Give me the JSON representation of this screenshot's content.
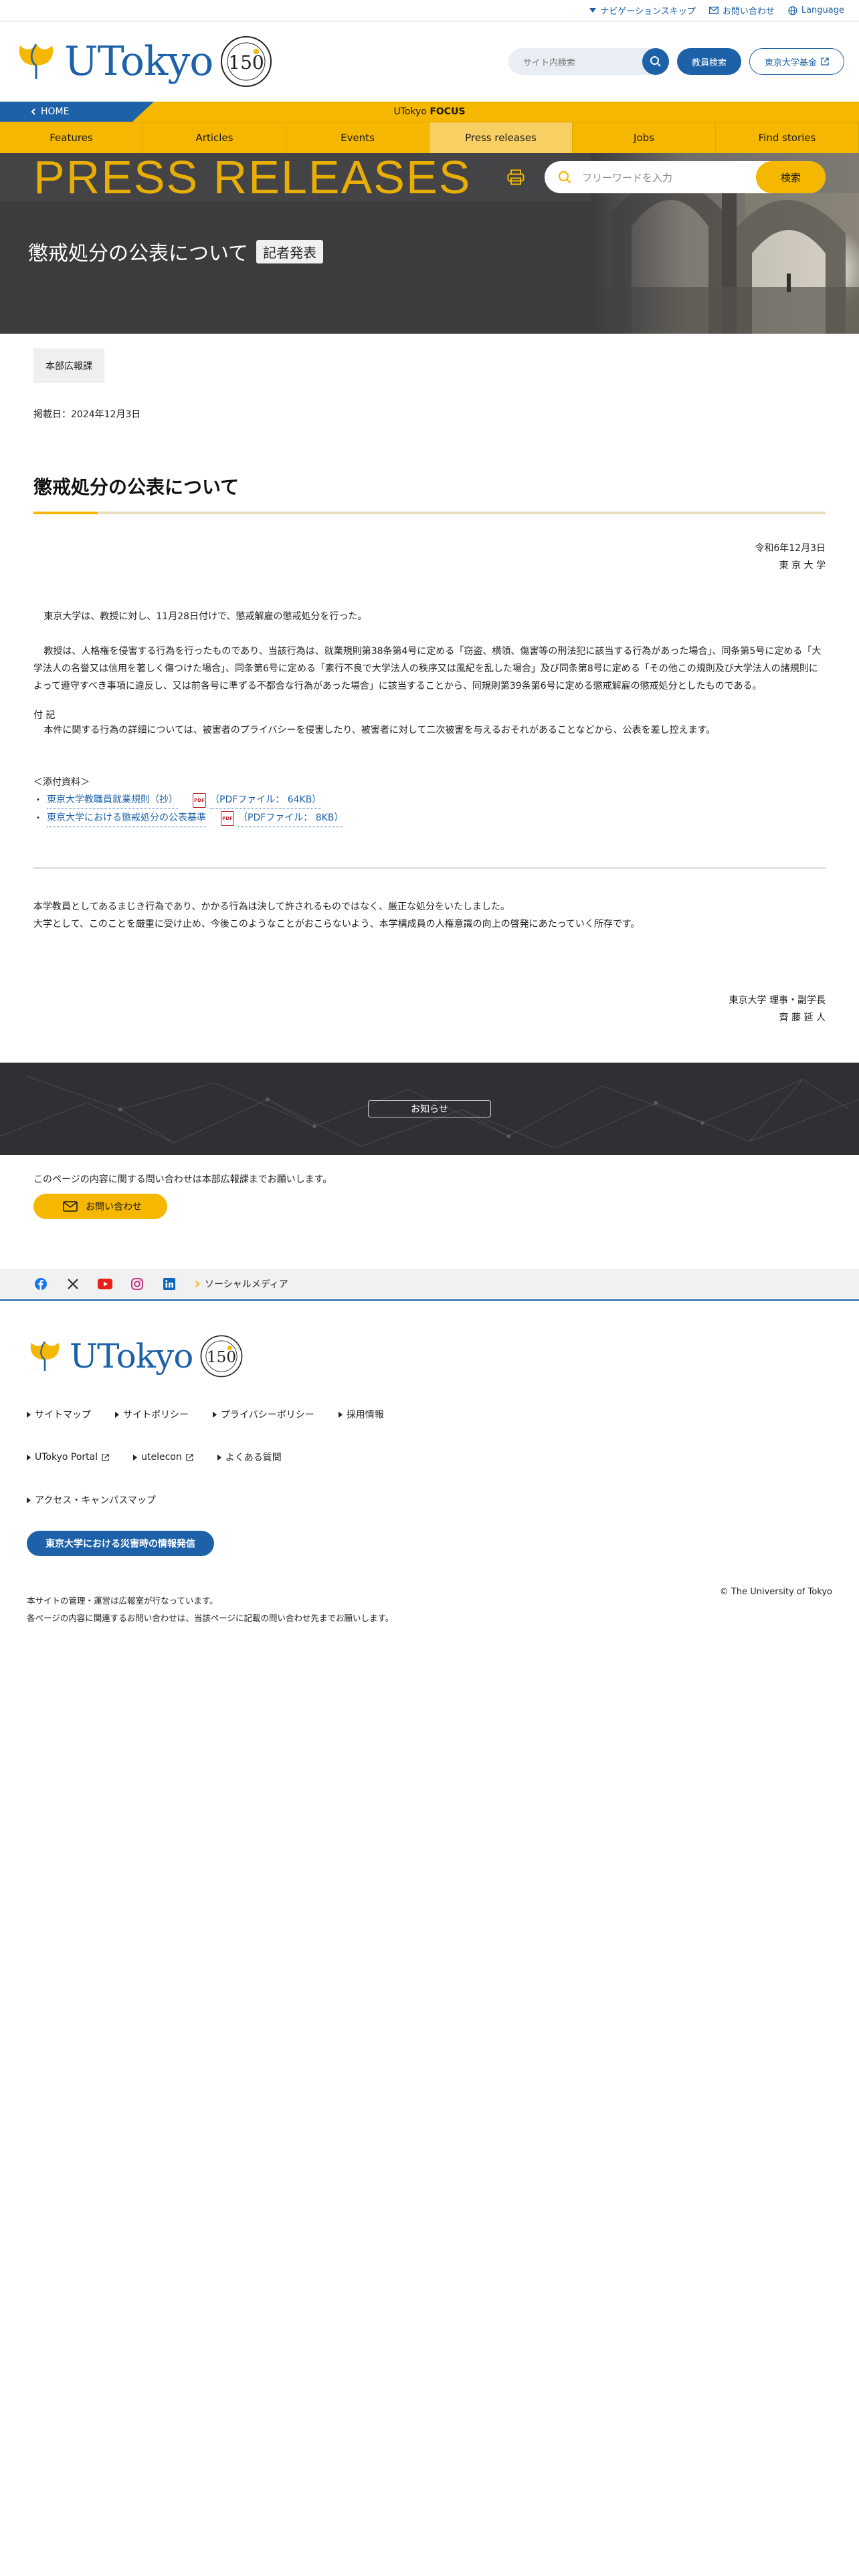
{
  "utility": {
    "skip": "ナビゲーションスキップ",
    "contact": "お問い合わせ",
    "language": "Language"
  },
  "header": {
    "logo": "UTokyo",
    "search_placeholder": "サイト内検索",
    "faculty_search": "教員検索",
    "fund": "東京大学基金"
  },
  "focusbar": {
    "home": "HOME",
    "label_prefix": "UTokyo",
    "label_bold": "FOCUS"
  },
  "nav": {
    "tabs": [
      "Features",
      "Articles",
      "Events",
      "Press releases",
      "Jobs",
      "Find stories"
    ],
    "active_index": 3
  },
  "hero": {
    "kicker": "PRESS RELEASES",
    "keyword_placeholder": "フリーワードを入力",
    "search_button": "検索",
    "title": "懲戒処分の公表について",
    "tag": "記者発表"
  },
  "article": {
    "department": "本部広報課",
    "posted": "掲載日：2024年12月3日",
    "title": "懲戒処分の公表について",
    "date_line": "令和6年12月3日",
    "org_line": "東 京 大 学",
    "para1": "東京大学は、教授に対し、11月28日付けで、懲戒解雇の懲戒処分を行った。",
    "para2": "教授は、人格権を侵害する行為を行ったものであり、当該行為は、就業規則第38条第4号に定める「窃盗、横領、傷害等の刑法犯に該当する行為があった場合」、同条第5号に定める「大学法人の名誉又は信用を著しく傷つけた場合」、同条第6号に定める「素行不良で大学法人の秩序又は風紀を乱した場合」及び同条第8号に定める「その他この規則及び大学法人の諸規則によって遵守すべき事項に違反し、又は前各号に準ずる不都合な行為があった場合」に該当することから、同規則第39条第6号に定める懲戒解雇の懲戒処分としたものである。",
    "note_head": "付 記",
    "note": "本件に関する行為の詳細については、被害者のプライバシーを侵害したり、被害者に対して二次被害を与えるおそれがあることなどから、公表を差し控えます。",
    "attach_head": "＜添付資料＞",
    "attachments": [
      {
        "label": "東京大学教職員就業規則（抄）",
        "size": "（PDFファイル： 64KB）"
      },
      {
        "label": "東京大学における懲戒処分の公表基準",
        "size": "（PDFファイル： 8KB）"
      }
    ],
    "closing1": "本学教員としてあるまじき行為であり、かかる行為は決して許されるものではなく、厳正な処分をいたしました。",
    "closing2": "大学として、このことを厳重に受け止め、今後このようなことがおこらないよう、本学構成員の人権意識の向上の啓発にあたっていく所存です。",
    "sign1": "東京大学 理事・副学長",
    "sign2": "齊 藤 延 人"
  },
  "notice": {
    "button": "お知らせ"
  },
  "contact": {
    "text": "このページの内容に関する問い合わせは本部広報課までお願いします。",
    "button": "お問い合わせ"
  },
  "social": {
    "label": "ソーシャルメディア"
  },
  "footer": {
    "links": [
      "サイトマップ",
      "サイトポリシー",
      "プライバシーポリシー",
      "採用情報",
      "UTokyo Portal",
      "utelecon",
      "よくある質問",
      "アクセス・キャンパスマップ"
    ],
    "disaster": "東京大学における災害時の情報発信",
    "meta1": "本サイトの管理・運営は広報室が行なっています。",
    "meta2": "各ページの内容に関連するお問い合わせは、当該ページに記載の問い合わせ先までお願いします。",
    "copyright": "© The University of Tokyo"
  },
  "colors": {
    "brand_blue": "#1d62a8",
    "accent_yellow": "#f5b700",
    "dark": "#2f3033"
  }
}
